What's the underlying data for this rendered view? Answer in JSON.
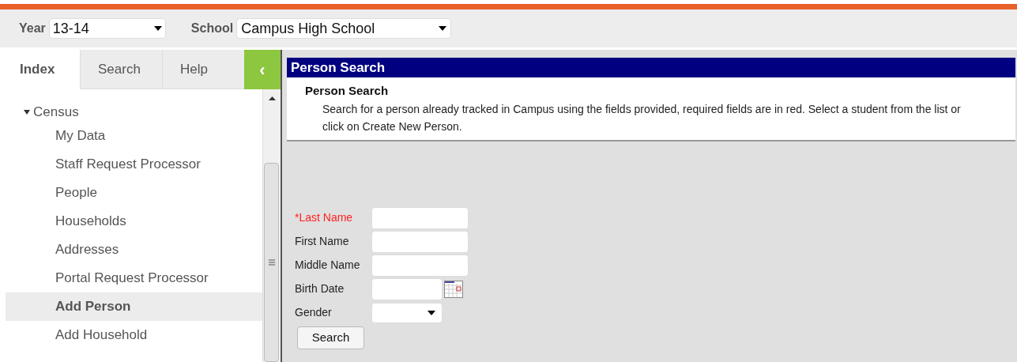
{
  "toolbar": {
    "year": {
      "label": "Year",
      "value": "13-14"
    },
    "school": {
      "label": "School",
      "value": "Campus High School"
    }
  },
  "tabs": [
    {
      "label": "Index",
      "selected": true
    },
    {
      "label": "Search",
      "selected": false
    },
    {
      "label": "Help",
      "selected": false
    }
  ],
  "collapse_button": "‹",
  "tree": {
    "label": "Census",
    "expanded": true,
    "children": [
      {
        "label": "My Data",
        "selected": false
      },
      {
        "label": "Staff Request Processor",
        "selected": false
      },
      {
        "label": "People",
        "selected": false
      },
      {
        "label": "Households",
        "selected": false
      },
      {
        "label": "Addresses",
        "selected": false
      },
      {
        "label": "Portal Request Processor",
        "selected": false
      },
      {
        "label": "Add Person",
        "selected": true
      },
      {
        "label": "Add Household",
        "selected": false
      }
    ]
  },
  "panel": {
    "title": "Person Search",
    "subtitle": "Person Search",
    "description": "Search for a person already tracked in Campus using the fields provided, required fields are in red. Select a student from the list or click on Create New Person."
  },
  "form": {
    "fields": [
      {
        "label": "*Last Name",
        "kind": "text",
        "required": true
      },
      {
        "label": "First Name",
        "kind": "text",
        "required": false
      },
      {
        "label": "Middle Name",
        "kind": "text",
        "required": false
      },
      {
        "label": "Birth Date",
        "kind": "date",
        "required": false
      },
      {
        "label": "Gender",
        "kind": "select",
        "required": false
      }
    ],
    "button": "Search"
  }
}
